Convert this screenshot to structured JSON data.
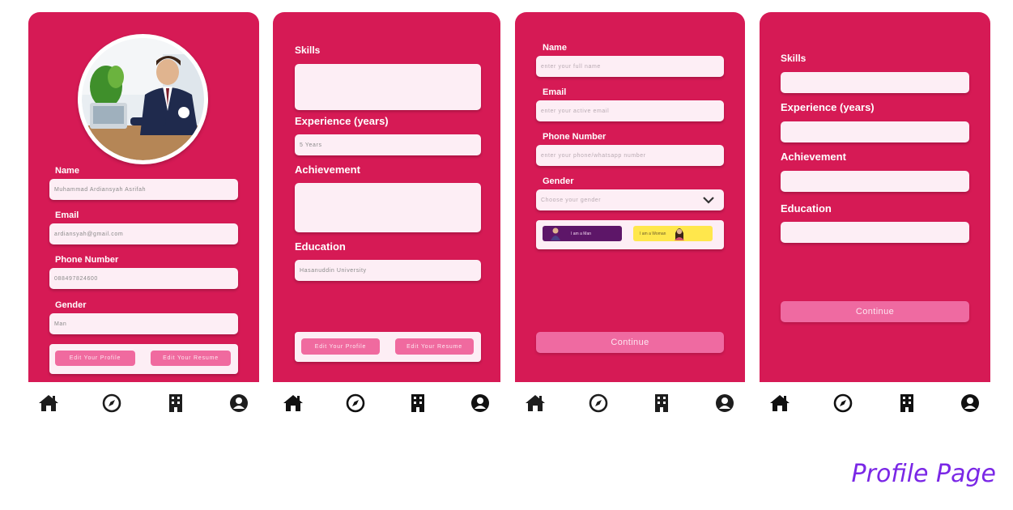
{
  "colors": {
    "brand": "#d61a55",
    "field_bg": "#fdeef5",
    "button_pink": "#f06a9f",
    "caption_purple": "#7a27e6",
    "woman_chip": "#ffe74c",
    "man_chip": "#5d1668"
  },
  "caption": "Profile Page",
  "nav_icons": [
    "home-icon",
    "compass-icon",
    "building-icon",
    "user-circle-icon"
  ],
  "screen1": {
    "avatar_alt": "profile photo",
    "name_label": "Name",
    "name_value": "Muhammad Ardiansyah Asrifah",
    "email_label": "Email",
    "email_value": "ardiansyah@gmail.com",
    "phone_label": "Phone Number",
    "phone_value": "088497824600",
    "gender_label": "Gender",
    "gender_value": "Man",
    "edit_profile": "Edit Your Profile",
    "edit_resume": "Edit Your Resume"
  },
  "screen2": {
    "skills_label": "Skills",
    "skills_value": "",
    "experience_label": "Experience (years)",
    "experience_value": "5 Years",
    "achievement_label": "Achievement",
    "achievement_value": "",
    "education_label": "Education",
    "education_value": "Hasanuddin University",
    "edit_profile": "Edit Your Profile",
    "edit_resume": "Edit Your Resume"
  },
  "screen3": {
    "name_label": "Name",
    "name_placeholder": "enter your full name",
    "email_label": "Email",
    "email_placeholder": "enter your active email",
    "phone_label": "Phone Number",
    "phone_placeholder": "enter your phone/whatsapp number",
    "gender_label": "Gender",
    "gender_placeholder": "Choose your gender",
    "man_option": "I am a Man",
    "woman_option": "I am a Woman",
    "continue": "Continue"
  },
  "screen4": {
    "skills_label": "Skills",
    "experience_label": "Experience (years)",
    "achievement_label": "Achievement",
    "education_label": "Education",
    "continue": "Continue"
  }
}
